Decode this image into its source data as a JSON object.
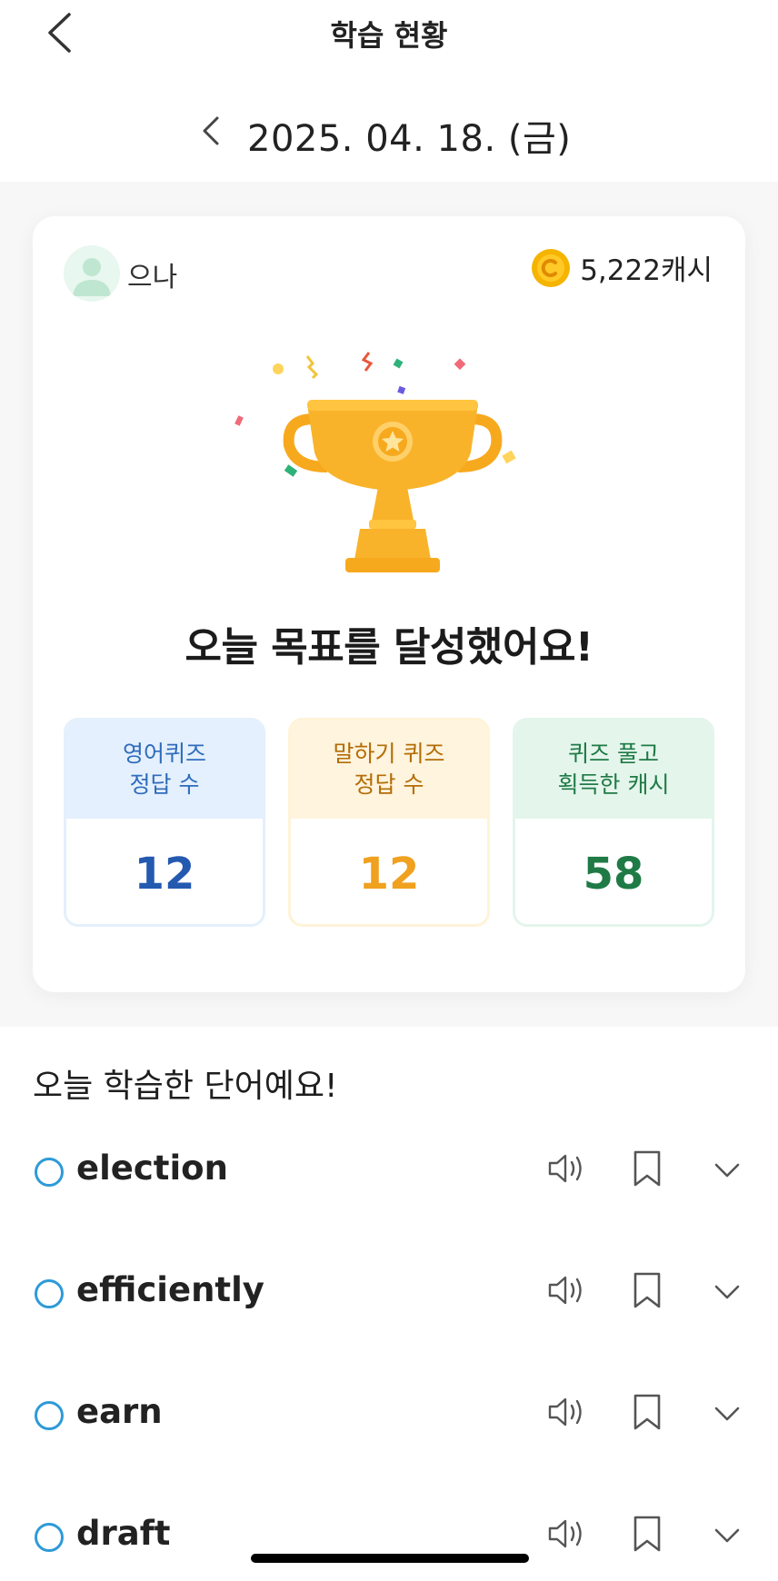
{
  "header": {
    "title": "학습 현황"
  },
  "date": {
    "label": "2025. 04. 18. (금)"
  },
  "card": {
    "user": {
      "name": "으나"
    },
    "cash": {
      "value": "5,222캐시"
    },
    "achievement": "오늘 목표를 달성했어요!",
    "stats": [
      {
        "line1": "영어퀴즈",
        "line2": "정답 수",
        "value": "12"
      },
      {
        "line1": "말하기 퀴즈",
        "line2": "정답 수",
        "value": "12"
      },
      {
        "line1": "퀴즈 풀고",
        "line2": "획득한 캐시",
        "value": "58"
      }
    ]
  },
  "words_section": {
    "title": "오늘 학습한 단어예요!",
    "words": [
      "election",
      "efficiently",
      "earn",
      "draft"
    ]
  },
  "colors": {
    "accent_blue": "#2e9ad8",
    "quiz_blue": "#2459b0",
    "speaking_orange": "#f0a11f",
    "cash_green": "#1f7a45",
    "coin_gold": "#f5b400"
  },
  "icons": {
    "back": "chevron-left-icon",
    "date_prev": "chevron-left-icon",
    "coin": "coin-icon",
    "trophy": "trophy-icon",
    "speaker": "speaker-icon",
    "bookmark": "bookmark-icon",
    "expand": "chevron-down-icon"
  }
}
